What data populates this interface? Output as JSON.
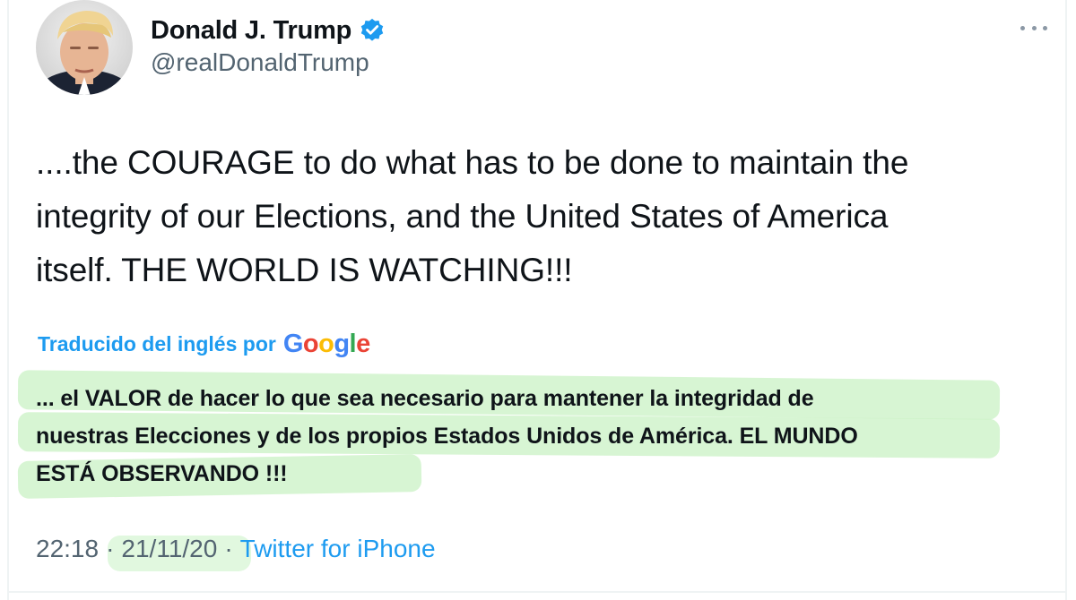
{
  "tweet": {
    "author": {
      "display_name": "Donald J. Trump",
      "handle": "@realDonaldTrump",
      "verified": true,
      "avatar_icon": "profile-photo"
    },
    "more_icon": "ellipsis-icon",
    "text_lines": [
      "....the COURAGE to do what has to be done to maintain the",
      "integrity of our Elections,  and the United States of America",
      "itself. THE WORLD IS WATCHING!!!"
    ],
    "translation": {
      "label": "Traducido del inglés por",
      "provider": "Google",
      "lines": [
        "... el VALOR de hacer lo que sea necesario para mantener la integridad de",
        "nuestras Elecciones y de los propios Estados Unidos de América. EL MUNDO",
        "ESTÁ OBSERVANDO !!!"
      ]
    },
    "meta": {
      "time": "22:18",
      "date": "21/11/20",
      "separator": "·",
      "source": "Twitter for iPhone"
    }
  },
  "colors": {
    "link_blue": "#1d9bf0",
    "secondary_text": "#536471",
    "highlight_green": "#c9f2c4",
    "google_blue": "#4285F4",
    "google_red": "#EA4335",
    "google_yellow": "#FBBC05",
    "google_green": "#34A853"
  }
}
